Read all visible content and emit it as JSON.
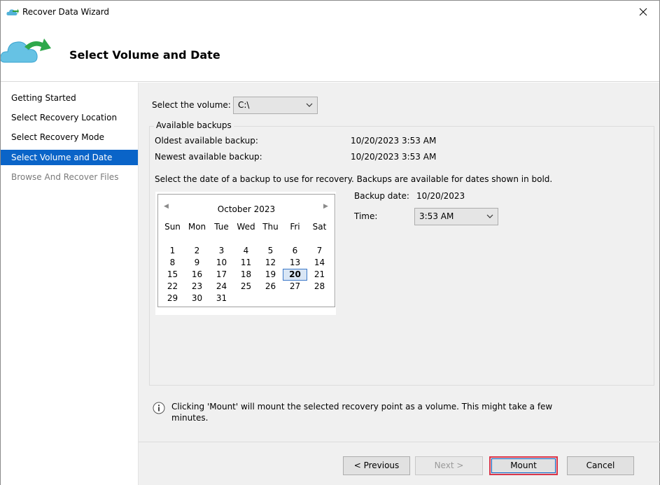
{
  "window": {
    "title": "Recover Data Wizard"
  },
  "banner": {
    "heading": "Select Volume and Date"
  },
  "nav": {
    "items": [
      {
        "label": "Getting Started",
        "state": "normal"
      },
      {
        "label": "Select Recovery Location",
        "state": "normal"
      },
      {
        "label": "Select Recovery Mode",
        "state": "normal"
      },
      {
        "label": "Select Volume and Date",
        "state": "active"
      },
      {
        "label": "Browse And Recover Files",
        "state": "disabled"
      }
    ]
  },
  "volume": {
    "label": "Select the volume:",
    "value": "C:\\"
  },
  "backups": {
    "group_title": "Available backups",
    "oldest_label": "Oldest available backup:",
    "oldest_value": "10/20/2023 3:53 AM",
    "newest_label": "Newest available backup:",
    "newest_value": "10/20/2023 3:53 AM",
    "instructions": "Select the date of a backup to use for recovery. Backups are available for dates shown in bold.",
    "backup_date_label": "Backup date:",
    "backup_date_value": "10/20/2023",
    "time_label": "Time:",
    "time_value": "3:53 AM"
  },
  "calendar": {
    "prev": "◀",
    "next": "▶",
    "month_title": "October 2023",
    "weekdays": [
      "Sun",
      "Mon",
      "Tue",
      "Wed",
      "Thu",
      "Fri",
      "Sat"
    ],
    "weeks": [
      [
        "1",
        "2",
        "3",
        "4",
        "5",
        "6",
        "7"
      ],
      [
        "8",
        "9",
        "10",
        "11",
        "12",
        "13",
        "14"
      ],
      [
        "15",
        "16",
        "17",
        "18",
        "19",
        "20",
        "21"
      ],
      [
        "22",
        "23",
        "24",
        "25",
        "26",
        "27",
        "28"
      ],
      [
        "29",
        "30",
        "31",
        "",
        "",
        "",
        ""
      ]
    ],
    "selected_day": "20"
  },
  "info": {
    "text": "Clicking 'Mount' will mount the selected recovery point as a volume. This might take a few minutes."
  },
  "buttons": {
    "previous": "< Previous",
    "next": "Next >",
    "mount": "Mount",
    "cancel": "Cancel"
  },
  "colors": {
    "accent": "#0a64c8",
    "mount_highlight": "#d9364a",
    "content_bg": "#f0f0f0"
  },
  "icons": {
    "app": "cloud-recover-icon",
    "banner": "cloud-arrow-icon",
    "close": "close-icon",
    "info": "info-icon",
    "dropdown": "chevron-down-icon"
  }
}
